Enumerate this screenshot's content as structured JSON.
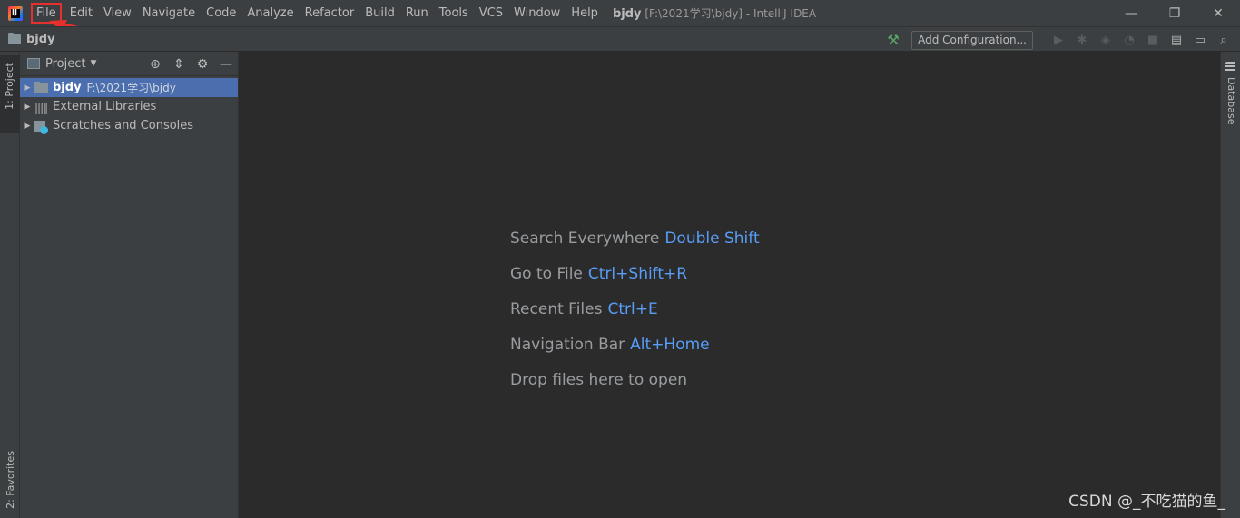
{
  "window": {
    "project_name": "bjdy",
    "title_rest": "[F:\\2021学习\\bjdy] - IntelliJ IDEA",
    "controls": {
      "minimize": "—",
      "restore": "❐",
      "close": "✕"
    }
  },
  "menu": [
    "File",
    "Edit",
    "View",
    "Navigate",
    "Code",
    "Analyze",
    "Refactor",
    "Build",
    "Run",
    "Tools",
    "VCS",
    "Window",
    "Help"
  ],
  "navbar": {
    "breadcrumb": "bjdy",
    "add_configuration": "Add Configuration...",
    "icons": [
      "hammer-icon",
      "run-icon",
      "debug-icon",
      "coverage-icon",
      "profile-icon",
      "stop-icon",
      "project-structure-icon",
      "toolwindow-icon",
      "search-icon"
    ]
  },
  "left_strip": {
    "project_tab": "1: Project",
    "favorites_tab": "2: Favorites"
  },
  "project_panel": {
    "title": "Project",
    "tree": [
      {
        "label": "bjdy",
        "path": "F:\\2021学习\\bjdy",
        "icon": "folder-icon"
      },
      {
        "label": "External Libraries",
        "icon": "libraries-icon"
      },
      {
        "label": "Scratches and Consoles",
        "icon": "scratches-icon"
      }
    ]
  },
  "editor": {
    "hints": [
      {
        "text": "Search Everywhere",
        "shortcut": "Double Shift"
      },
      {
        "text": "Go to File",
        "shortcut": "Ctrl+Shift+R"
      },
      {
        "text": "Recent Files",
        "shortcut": "Ctrl+E"
      },
      {
        "text": "Navigation Bar",
        "shortcut": "Alt+Home"
      },
      {
        "text": "Drop files here to open",
        "shortcut": ""
      }
    ]
  },
  "right_strip": {
    "database_tab": "Database"
  },
  "watermark": "CSDN @_不吃猫的鱼_",
  "colors": {
    "accent_blue": "#589df6",
    "annotation_red": "#e5302d",
    "selection": "#4b6eaf"
  }
}
